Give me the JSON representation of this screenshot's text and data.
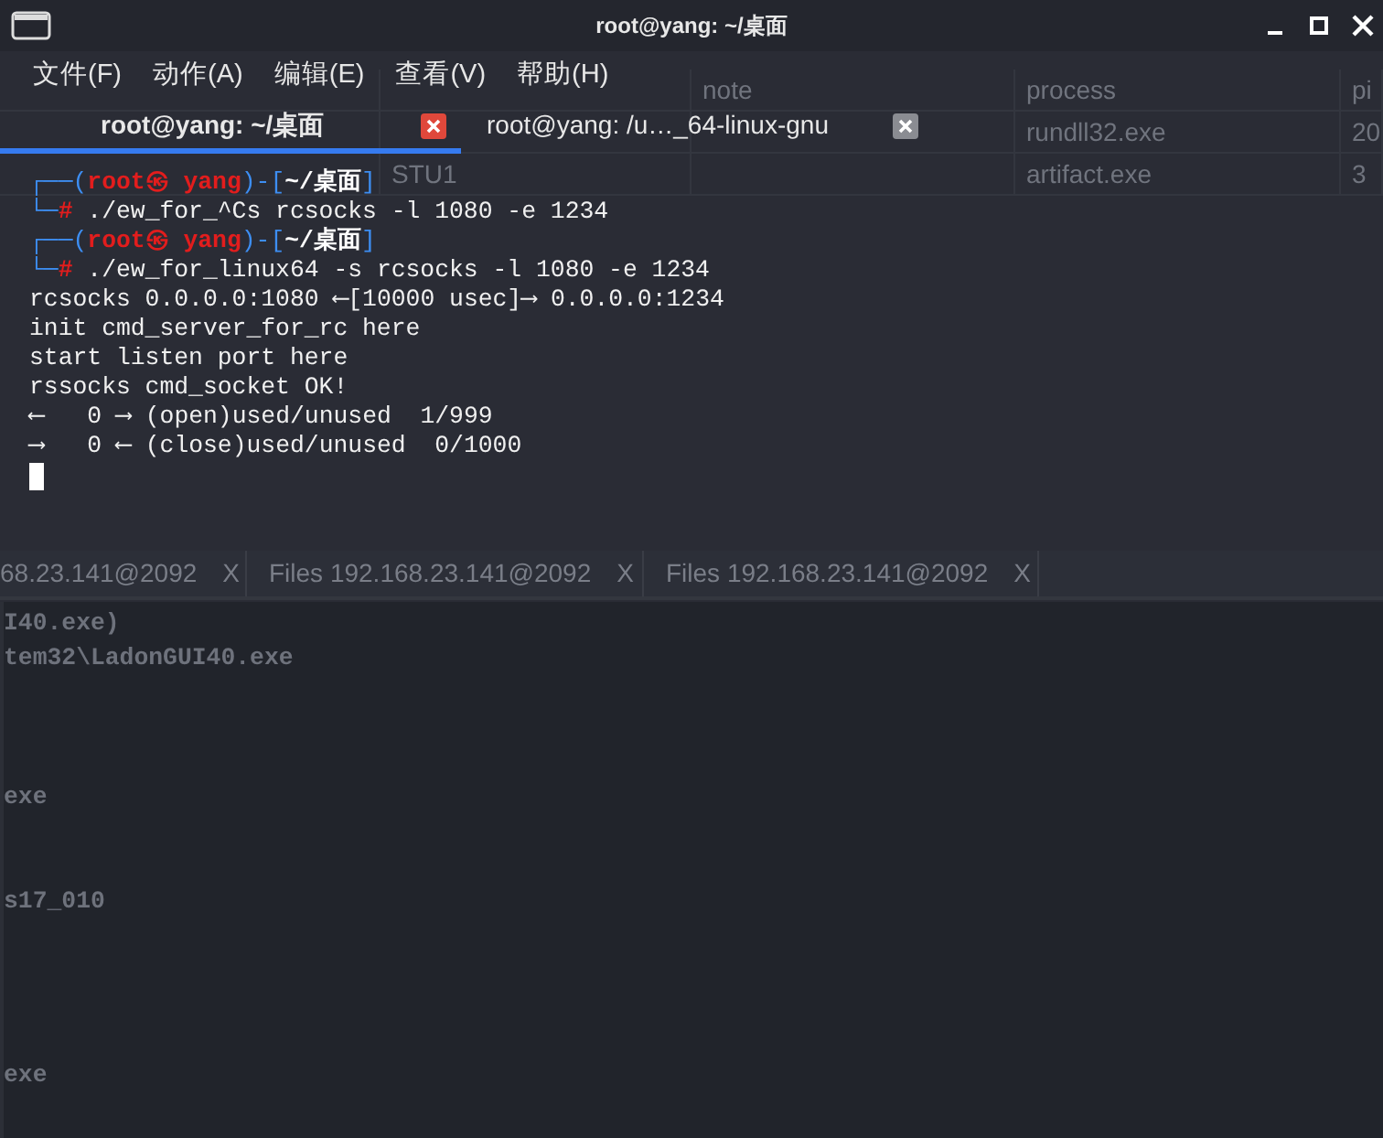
{
  "background_app": {
    "table": {
      "columns": [
        "",
        "",
        "note",
        "process",
        "pi"
      ],
      "rows": [
        {
          "cells": [
            "",
            "",
            "",
            "rundll32.exe",
            "20"
          ]
        },
        {
          "cells": [
            "",
            "STU1",
            "",
            "artifact.exe",
            "3"
          ]
        }
      ]
    },
    "tabs": [
      {
        "label": "68.23.141@2092",
        "close": "X"
      },
      {
        "label": "Files 192.168.23.141@2092",
        "close": "X"
      },
      {
        "label": "Files 192.168.23.141@2092",
        "close": "X"
      }
    ],
    "console": [
      "I40.exe)",
      "tem32\\LadonGUI40.exe",
      "exe",
      "s17_010",
      "exe"
    ]
  },
  "window": {
    "title": "root@yang: ~/桌面"
  },
  "menu": [
    "文件(F)",
    "动作(A)",
    "编辑(E)",
    "查看(V)",
    "帮助(H)"
  ],
  "tabs": [
    {
      "label": "root@yang: ~/桌面",
      "selected": true
    },
    {
      "label": "root@yang: /u…_64-linux-gnu",
      "selected": false
    }
  ],
  "terminal": [
    {
      "kind": "text",
      "segments": [
        {
          "kind": "frame",
          "text": "┌──("
        },
        {
          "kind": "user",
          "text": "root㉿ yang"
        },
        {
          "kind": "frame",
          "text": ")-["
        },
        {
          "kind": "path",
          "text": "~/桌面"
        },
        {
          "kind": "frame",
          "text": "]"
        }
      ]
    },
    {
      "kind": "text",
      "segments": [
        {
          "kind": "frame",
          "text": "└─"
        },
        {
          "kind": "hash",
          "text": "#"
        },
        {
          "kind": "plain",
          "text": " ./ew_for_^Cs rcsocks -l 1080 -e 1234"
        }
      ]
    },
    {
      "kind": "text",
      "segments": [
        {
          "kind": "frame",
          "text": "┌──("
        },
        {
          "kind": "user",
          "text": "root㉿ yang"
        },
        {
          "kind": "frame",
          "text": ")-["
        },
        {
          "kind": "path",
          "text": "~/桌面"
        },
        {
          "kind": "frame",
          "text": "]"
        }
      ]
    },
    {
      "kind": "text",
      "segments": [
        {
          "kind": "frame",
          "text": "└─"
        },
        {
          "kind": "hash",
          "text": "#"
        },
        {
          "kind": "plain",
          "text": " ./ew_for_linux64 -s rcsocks -l 1080 -e 1234"
        }
      ]
    },
    {
      "kind": "text",
      "segments": [
        {
          "kind": "plain",
          "text": "rcsocks 0.0.0.0:1080 ⟵[10000 usec]⟶ 0.0.0.0:1234"
        }
      ]
    },
    {
      "kind": "text",
      "segments": [
        {
          "kind": "plain",
          "text": "init cmd_server_for_rc here"
        }
      ]
    },
    {
      "kind": "text",
      "segments": [
        {
          "kind": "plain",
          "text": "start listen port here"
        }
      ]
    },
    {
      "kind": "text",
      "segments": [
        {
          "kind": "plain",
          "text": "rssocks cmd_socket OK!"
        }
      ]
    },
    {
      "kind": "text",
      "segments": [
        {
          "kind": "plain",
          "text": "⟵   0 ⟶ (open)used/unused  1/999"
        }
      ]
    },
    {
      "kind": "text",
      "segments": [
        {
          "kind": "plain",
          "text": "⟶   0 ⟵ (close)used/unused  0/1000"
        }
      ]
    },
    {
      "kind": "cursor"
    }
  ]
}
